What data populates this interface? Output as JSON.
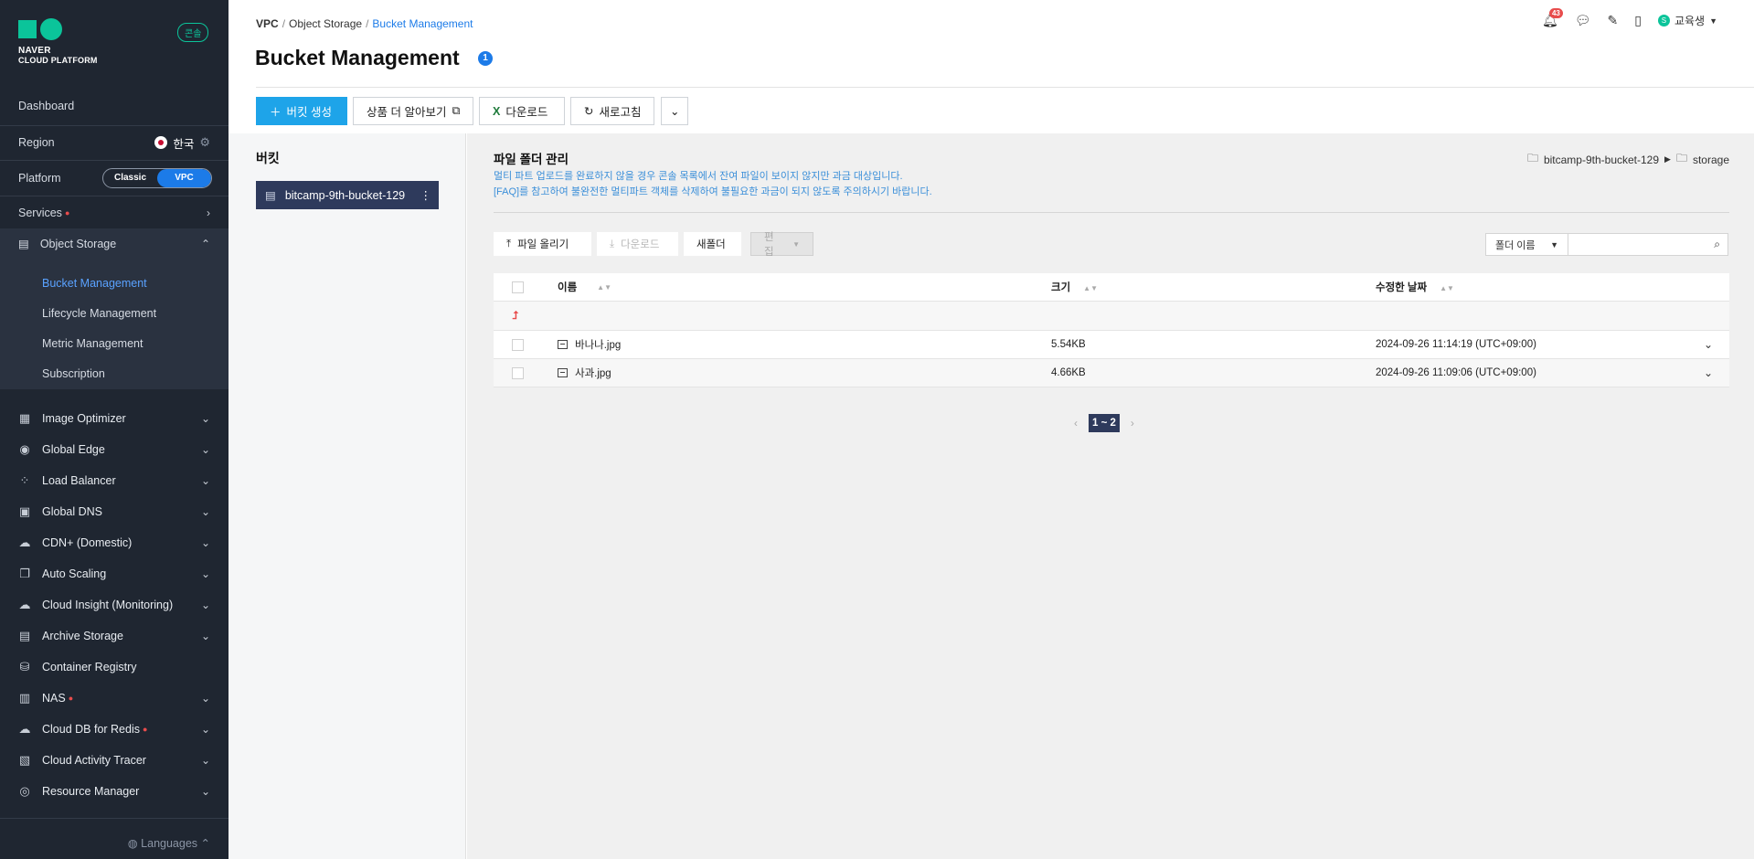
{
  "sidebar": {
    "logo": {
      "line1": "NAVER",
      "line2": "CLOUD PLATFORM"
    },
    "console_badge": "콘솔",
    "dashboard": "Dashboard",
    "region_label": "Region",
    "region_value": "한국",
    "platform_label": "Platform",
    "platform_options": [
      "Classic",
      "VPC"
    ],
    "services_label": "Services",
    "object_storage": "Object Storage",
    "sub_items": [
      "Bucket Management",
      "Lifecycle Management",
      "Metric Management",
      "Subscription"
    ],
    "services": [
      {
        "label": "Image Optimizer",
        "icon": "image-optimizer-icon"
      },
      {
        "label": "Global Edge",
        "icon": "global-edge-icon"
      },
      {
        "label": "Load Balancer",
        "icon": "load-balancer-icon"
      },
      {
        "label": "Global DNS",
        "icon": "dns-icon"
      },
      {
        "label": "CDN+ (Domestic)",
        "icon": "cdn-icon"
      },
      {
        "label": "Auto Scaling",
        "icon": "auto-scaling-icon"
      },
      {
        "label": "Cloud Insight (Monitoring)",
        "icon": "monitoring-icon"
      },
      {
        "label": "Archive Storage",
        "icon": "archive-icon"
      },
      {
        "label": "Container Registry",
        "icon": "registry-icon"
      },
      {
        "label": "NAS",
        "icon": "nas-icon"
      },
      {
        "label": "Cloud DB for Redis",
        "icon": "redis-icon"
      },
      {
        "label": "Cloud Activity Tracer",
        "icon": "tracer-icon"
      },
      {
        "label": "Resource Manager",
        "icon": "resource-manager-icon"
      }
    ],
    "languages": "Languages"
  },
  "header": {
    "breadcrumb": [
      "VPC",
      "Object Storage",
      "Bucket Management"
    ],
    "title": "Bucket Management",
    "info_count": "1",
    "notification_count": "43",
    "user_initial": "S",
    "user_name": "교육생"
  },
  "toolbar": {
    "create": "버킷 생성",
    "learn_more": "상품 더 알아보기",
    "download": "다운로드",
    "refresh": "새로고침"
  },
  "buckets": {
    "title": "버킷",
    "items": [
      "bitcamp-9th-bucket-129"
    ]
  },
  "folder": {
    "title": "파일 폴더 관리",
    "note1": "멀티 파트 업로드를 완료하지 않을 경우 콘솔 목록에서 잔여 파일이 보이지 않지만 과금 대상입니다.",
    "note2": "[FAQ]를 참고하여 불완전한 멀티파트 객체를 삭제하여 불필요한 과금이 되지 않도록 주의하시기 바랍니다.",
    "path": [
      "bitcamp-9th-bucket-129",
      "storage"
    ],
    "buttons": {
      "upload": "파일 올리기",
      "download": "다운로드",
      "new_folder": "새폴더",
      "edit": "편집"
    },
    "search_select": "폴더 이름",
    "search_value": ""
  },
  "table": {
    "columns": [
      "이름",
      "크기",
      "수정한 날짜"
    ],
    "rows": [
      {
        "name": "바나나.jpg",
        "size": "5.54KB",
        "date": "2024-09-26 11:14:19 (UTC+09:00)"
      },
      {
        "name": "사과.jpg",
        "size": "4.66KB",
        "date": "2024-09-26 11:09:06 (UTC+09:00)"
      }
    ]
  },
  "pager": {
    "range": "1 ~ 2"
  },
  "colors": {
    "accent": "#1c7be8",
    "primary_button": "#1ea4e9",
    "sidebar_bg": "#1f2631",
    "brand": "#0bc49a"
  }
}
